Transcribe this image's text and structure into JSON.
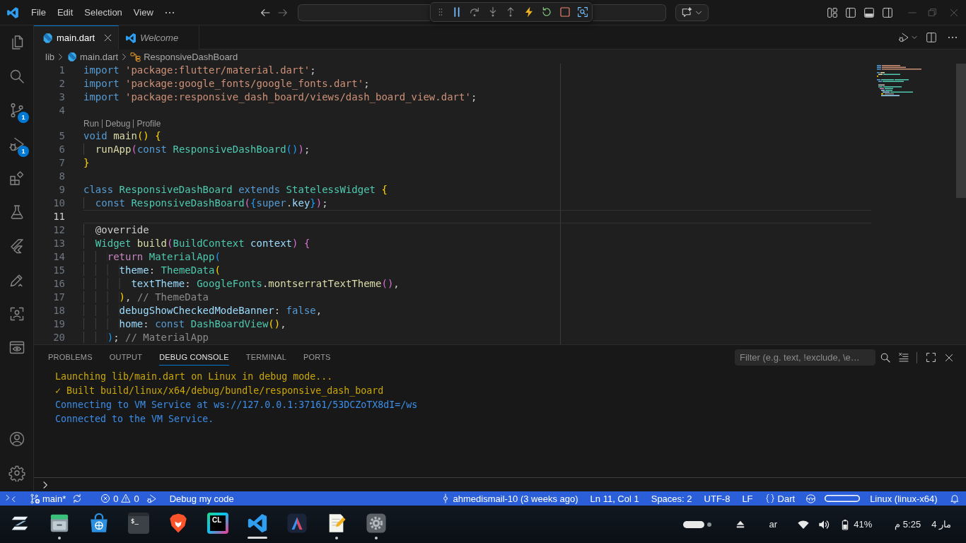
{
  "title_bar": {
    "menu": [
      "File",
      "Edit",
      "Selection",
      "View"
    ],
    "navigation": [
      {
        "kind": "back",
        "disabled": false
      },
      {
        "kind": "forward",
        "disabled": true
      }
    ]
  },
  "debug_toolbar": {
    "actions": [
      {
        "kind": "pause",
        "disabled": false
      },
      {
        "kind": "step-over",
        "disabled": true
      },
      {
        "kind": "step-into",
        "disabled": true
      },
      {
        "kind": "step-out",
        "disabled": true
      },
      {
        "kind": "hot-reload",
        "disabled": false
      },
      {
        "kind": "restart",
        "disabled": false
      },
      {
        "kind": "stop",
        "disabled": false
      },
      {
        "kind": "inspect",
        "disabled": false
      }
    ]
  },
  "activity_bar": {
    "items": [
      {
        "kind": "explorer"
      },
      {
        "kind": "search"
      },
      {
        "kind": "scm",
        "badge": "1"
      },
      {
        "kind": "debug",
        "badge": "1"
      },
      {
        "kind": "extensions"
      },
      {
        "kind": "testing"
      },
      {
        "kind": "flutter"
      },
      {
        "kind": "pen"
      },
      {
        "kind": "scan"
      },
      {
        "kind": "preview"
      }
    ],
    "bottom": [
      {
        "kind": "account"
      },
      {
        "kind": "settings"
      }
    ]
  },
  "tabs": [
    {
      "label": "main.dart",
      "kind": "dart",
      "selected": true,
      "preview": false
    },
    {
      "label": "Welcome",
      "kind": "vscode",
      "selected": false,
      "preview": true
    }
  ],
  "breadcrumb": [
    {
      "label": "lib",
      "kind": "folder"
    },
    {
      "label": "main.dart",
      "kind": "dart"
    },
    {
      "label": "ResponsiveDashBoard",
      "kind": "class"
    }
  ],
  "editor": {
    "lines": [
      {
        "kind": "code",
        "number": "1",
        "current": false,
        "tokens": [
          {
            "text": "import",
            "kind": "keyword"
          },
          {
            "text": " 'package:flutter/material.dart'",
            "kind": "string"
          },
          {
            "text": ";",
            "kind": "plain"
          }
        ]
      },
      {
        "kind": "code",
        "number": "2",
        "current": false,
        "tokens": [
          {
            "text": "import",
            "kind": "keyword"
          },
          {
            "text": " 'package:google_fonts/google_fonts.dart'",
            "kind": "string"
          },
          {
            "text": ";",
            "kind": "plain"
          }
        ]
      },
      {
        "kind": "code",
        "number": "3",
        "current": false,
        "tokens": [
          {
            "text": "import",
            "kind": "keyword"
          },
          {
            "text": " 'package:responsive_dash_board/views/dash_board_view.dart'",
            "kind": "string"
          },
          {
            "text": ";",
            "kind": "plain"
          }
        ]
      },
      {
        "kind": "code",
        "number": "4",
        "current": false
      },
      {
        "kind": "codelens",
        "links": [
          "Run",
          "Debug",
          "Profile"
        ]
      },
      {
        "kind": "code",
        "number": "5",
        "current": false,
        "tokens": [
          {
            "text": "void",
            "kind": "keyword"
          },
          {
            "text": " main",
            "kind": "function"
          },
          {
            "text": "()",
            "kind": "bracket1"
          },
          {
            "text": " {",
            "kind": "bracket1"
          }
        ]
      },
      {
        "kind": "code",
        "number": "6",
        "current": false,
        "tokens": [
          {
            "text": "  runApp",
            "kind": "function"
          },
          {
            "text": "(",
            "kind": "bracket2"
          },
          {
            "text": "const",
            "kind": "keyword"
          },
          {
            "text": " ResponsiveDashBoard",
            "kind": "type"
          },
          {
            "text": "()",
            "kind": "bracket3"
          },
          {
            "text": ")",
            "kind": "bracket2"
          },
          {
            "text": ";",
            "kind": "plain"
          }
        ]
      },
      {
        "kind": "code",
        "number": "7",
        "current": false,
        "tokens": [
          {
            "text": "}",
            "kind": "bracket1"
          }
        ]
      },
      {
        "kind": "code",
        "number": "8",
        "current": false
      },
      {
        "kind": "code",
        "number": "9",
        "current": false,
        "tokens": [
          {
            "text": "class",
            "kind": "keyword"
          },
          {
            "text": " ResponsiveDashBoard",
            "kind": "type"
          },
          {
            "text": " extends",
            "kind": "keyword"
          },
          {
            "text": " StatelessWidget",
            "kind": "type"
          },
          {
            "text": " {",
            "kind": "bracket1"
          }
        ]
      },
      {
        "kind": "code",
        "number": "10",
        "current": false,
        "tokens": [
          {
            "text": "  const",
            "kind": "keyword"
          },
          {
            "text": " ResponsiveDashBoard",
            "kind": "type"
          },
          {
            "text": "(",
            "kind": "bracket2"
          },
          {
            "text": "{",
            "kind": "bracket3"
          },
          {
            "text": "super",
            "kind": "keyword"
          },
          {
            "text": ".",
            "kind": "plain"
          },
          {
            "text": "key",
            "kind": "variable"
          },
          {
            "text": "}",
            "kind": "bracket3"
          },
          {
            "text": ")",
            "kind": "bracket2"
          },
          {
            "text": ";",
            "kind": "plain"
          }
        ]
      },
      {
        "kind": "code",
        "number": "11",
        "current": true
      },
      {
        "kind": "code",
        "number": "12",
        "current": false,
        "tokens": [
          {
            "text": "  @override",
            "kind": "plain"
          }
        ]
      },
      {
        "kind": "code",
        "number": "13",
        "current": false,
        "tokens": [
          {
            "text": "  Widget",
            "kind": "type"
          },
          {
            "text": " build",
            "kind": "function"
          },
          {
            "text": "(",
            "kind": "bracket2"
          },
          {
            "text": "BuildContext",
            "kind": "type"
          },
          {
            "text": " context",
            "kind": "variable"
          },
          {
            "text": ")",
            "kind": "bracket2"
          },
          {
            "text": " {",
            "kind": "bracket2"
          }
        ]
      },
      {
        "kind": "code",
        "number": "14",
        "current": false,
        "tokens": [
          {
            "text": "    return",
            "kind": "control"
          },
          {
            "text": " MaterialApp",
            "kind": "type"
          },
          {
            "text": "(",
            "kind": "bracket3"
          }
        ]
      },
      {
        "kind": "code",
        "number": "15",
        "current": false,
        "tokens": [
          {
            "text": "      theme",
            "kind": "variable"
          },
          {
            "text": ": ",
            "kind": "plain"
          },
          {
            "text": "ThemeData",
            "kind": "type"
          },
          {
            "text": "(",
            "kind": "bracket1"
          }
        ]
      },
      {
        "kind": "code",
        "number": "16",
        "current": false,
        "tokens": [
          {
            "text": "        textTheme",
            "kind": "variable"
          },
          {
            "text": ": ",
            "kind": "plain"
          },
          {
            "text": "GoogleFonts",
            "kind": "type"
          },
          {
            "text": ".",
            "kind": "plain"
          },
          {
            "text": "montserratTextTheme",
            "kind": "function"
          },
          {
            "text": "()",
            "kind": "bracket2"
          },
          {
            "text": ",",
            "kind": "plain"
          }
        ]
      },
      {
        "kind": "code",
        "number": "17",
        "current": false,
        "tokens": [
          {
            "text": "      )",
            "kind": "bracket1"
          },
          {
            "text": ", ",
            "kind": "plain"
          },
          {
            "text": "// ThemeData",
            "kind": "label"
          }
        ]
      },
      {
        "kind": "code",
        "number": "18",
        "current": false,
        "tokens": [
          {
            "text": "      debugShowCheckedModeBanner",
            "kind": "variable"
          },
          {
            "text": ": ",
            "kind": "plain"
          },
          {
            "text": "false",
            "kind": "keyword"
          },
          {
            "text": ",",
            "kind": "plain"
          }
        ]
      },
      {
        "kind": "code",
        "number": "19",
        "current": false,
        "tokens": [
          {
            "text": "      home",
            "kind": "variable"
          },
          {
            "text": ": ",
            "kind": "plain"
          },
          {
            "text": "const",
            "kind": "keyword"
          },
          {
            "text": " DashBoardView",
            "kind": "type"
          },
          {
            "text": "()",
            "kind": "bracket1"
          },
          {
            "text": ",",
            "kind": "plain"
          }
        ]
      },
      {
        "kind": "code",
        "number": "20",
        "current": false,
        "tokens": [
          {
            "text": "    )",
            "kind": "bracket3"
          },
          {
            "text": "; ",
            "kind": "plain"
          },
          {
            "text": "// MaterialApp",
            "kind": "label"
          }
        ]
      }
    ]
  },
  "panel": {
    "tabs": [
      {
        "label": "PROBLEMS",
        "selected": false
      },
      {
        "label": "OUTPUT",
        "selected": false
      },
      {
        "label": "DEBUG CONSOLE",
        "selected": true
      },
      {
        "label": "TERMINAL",
        "selected": false
      },
      {
        "label": "PORTS",
        "selected": false
      }
    ],
    "filter": {
      "placeholder": "Filter (e.g. text, !exclude, \\e…"
    },
    "console": [
      {
        "text": "Launching lib/main.dart on Linux in debug mode...",
        "kind": "output"
      },
      {
        "text": "✓ Built build/linux/x64/debug/bundle/responsive_dash_board",
        "kind": "output"
      },
      {
        "text": "Connecting to VM Service at ws://127.0.0.1:37161/53DCZoTX8dI=/ws",
        "kind": "adapter"
      },
      {
        "text": "Connected to the VM Service.",
        "kind": "adapter"
      }
    ]
  },
  "status_bar": {
    "left": [
      {
        "kind": "remote"
      },
      {
        "kind": "branch",
        "text": "main*"
      },
      {
        "kind": "sync"
      },
      {
        "kind": "problems",
        "errors": "0",
        "warnings": "0"
      },
      {
        "kind": "debug",
        "text": "Debug my code"
      }
    ],
    "right": [
      {
        "kind": "blame",
        "text": "ahmedismail-10 (3 weeks ago)"
      },
      {
        "kind": "text",
        "text": "Ln 11, Col 1"
      },
      {
        "kind": "text",
        "text": "Spaces: 2"
      },
      {
        "kind": "text",
        "text": "UTF-8"
      },
      {
        "kind": "text",
        "text": "LF"
      },
      {
        "kind": "language",
        "text": "Dart"
      },
      {
        "kind": "copilot"
      },
      {
        "kind": "pill"
      },
      {
        "kind": "text",
        "text": "Linux (linux-x64)"
      },
      {
        "kind": "bell"
      }
    ]
  },
  "taskbar": {
    "apps": [
      {
        "kind": "launcher",
        "running": false,
        "selected": false
      },
      {
        "kind": "files",
        "running": true,
        "selected": false
      },
      {
        "kind": "store",
        "running": false,
        "selected": false
      },
      {
        "kind": "terminal",
        "label": "$_",
        "running": false,
        "selected": false
      },
      {
        "kind": "browser",
        "running": false,
        "selected": false
      },
      {
        "kind": "ide",
        "label": "CL",
        "running": false,
        "selected": false
      },
      {
        "kind": "vscode",
        "running": true,
        "selected": true
      },
      {
        "kind": "peak",
        "running": false,
        "selected": false
      },
      {
        "kind": "notes",
        "running": true,
        "selected": false
      },
      {
        "kind": "settings",
        "running": true,
        "selected": false
      }
    ],
    "tray": [
      {
        "kind": "workspaces"
      },
      {
        "kind": "eject"
      },
      {
        "kind": "keyboard",
        "text": "ar"
      },
      {
        "kind": "wifi"
      },
      {
        "kind": "volume"
      },
      {
        "kind": "battery",
        "text": "41%"
      }
    ],
    "clock": {
      "time": "5:25 م",
      "date": "مار 4"
    }
  }
}
